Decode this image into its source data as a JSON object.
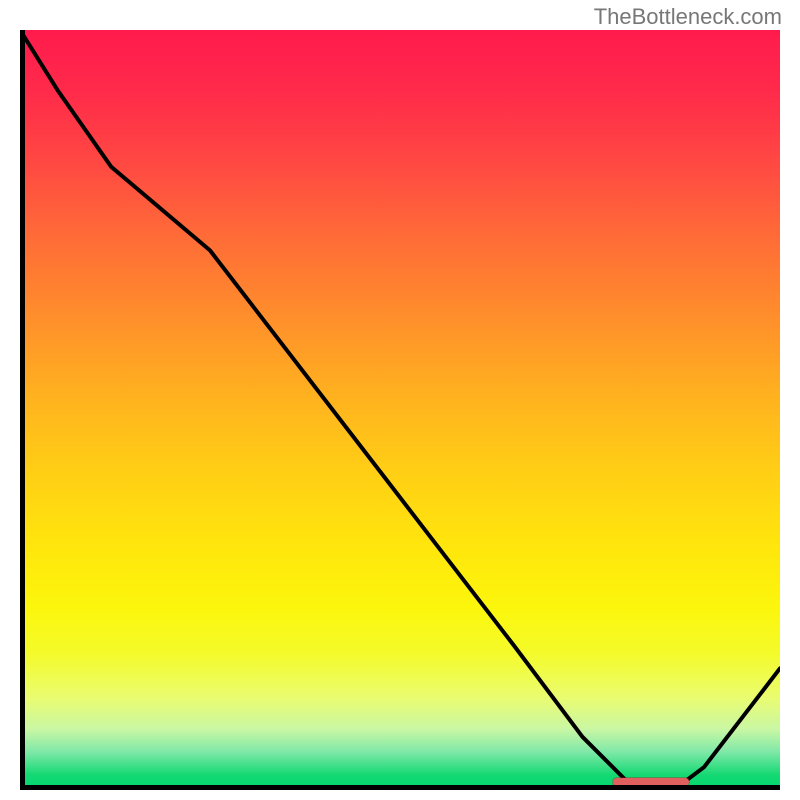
{
  "attribution": "TheBottleneck.com",
  "chart_data": {
    "type": "line",
    "title": "",
    "xlabel": "",
    "ylabel": "",
    "x": [
      0,
      5,
      12,
      25,
      35,
      45,
      55,
      65,
      74,
      80,
      86,
      90,
      100
    ],
    "values": [
      100,
      92,
      82,
      71,
      58,
      45,
      32,
      19,
      7,
      1,
      0,
      3,
      16
    ],
    "xlim": [
      0,
      100
    ],
    "ylim": [
      0,
      100
    ],
    "floor_region": {
      "x_start": 78,
      "x_end": 88,
      "y": 0
    },
    "background_gradient": [
      "#ff1b4d",
      "#ffce15",
      "#fcf60c",
      "#00d66e"
    ]
  },
  "colors": {
    "line": "#000000",
    "axis": "#000000",
    "floor_marker": "#e06060"
  }
}
